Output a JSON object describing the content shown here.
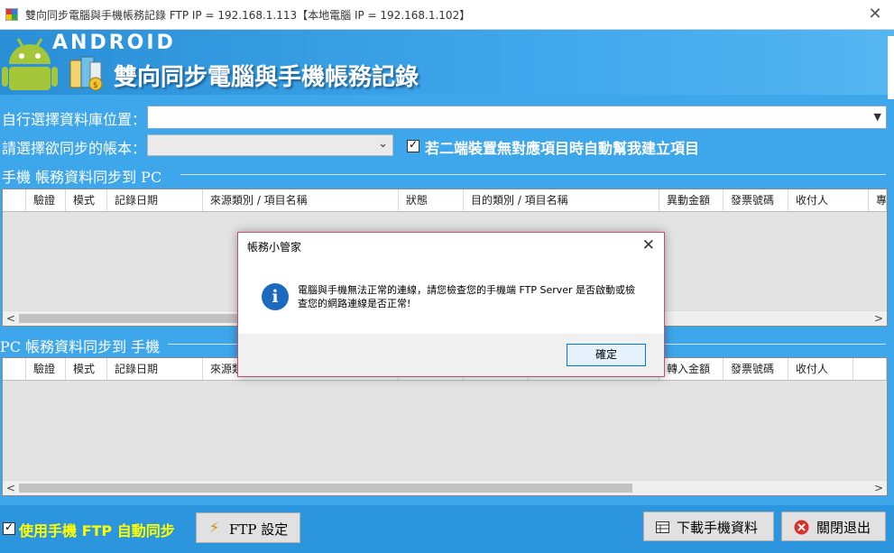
{
  "window": {
    "title": "雙向同步電腦與手機帳務記錄 FTP IP = 192.168.1.113【本地電腦 IP = 192.168.1.102】",
    "close_glyph": "✕"
  },
  "banner": {
    "android_text": "ANDROID",
    "title": "雙向同步電腦與手機帳務記錄"
  },
  "db_location": {
    "label": "自行選擇資料庫位置：",
    "value": ""
  },
  "account": {
    "label": "請選擇欲同步的帳本：",
    "value": ""
  },
  "auto_create": {
    "checked": true,
    "label": "若二端裝置無對應項目時自動幫我建立項目"
  },
  "section_phone_to_pc": {
    "title": "手機 帳務資料同步到 PC",
    "columns": [
      "驗證",
      "模式",
      "記錄日期",
      "來源類別 / 項目名稱",
      "狀態",
      "目的類別 / 項目名稱",
      "異動金額",
      "發票號碼",
      "收付人",
      "專"
    ]
  },
  "section_pc_to_phone": {
    "title": "PC 帳務資料同步到 手機",
    "columns": [
      "驗證",
      "模式",
      "記錄日期",
      "來源類",
      "",
      "",
      "",
      "轉入金額",
      "發票號碼",
      "收付人"
    ]
  },
  "bottom": {
    "auto_sync_checked": true,
    "auto_sync_label": "使用手機 FTP 自動同步",
    "ftp_settings_label": "FTP 設定",
    "download_label": "下載手機資料",
    "exit_label": "關閉退出"
  },
  "dialog": {
    "title": "帳務小管家",
    "message": "電腦與手機無法正常的連線，請您檢查您的手機端 FTP Server 是否啟動或檢查您的網路連線是否正常!",
    "ok_label": "確定",
    "icon_glyph": "i"
  },
  "colors": {
    "background": "#3ea6ea",
    "banner": "#2a8fd6",
    "yellow_text": "#ffff00",
    "dialog_border": "#c0507a"
  }
}
